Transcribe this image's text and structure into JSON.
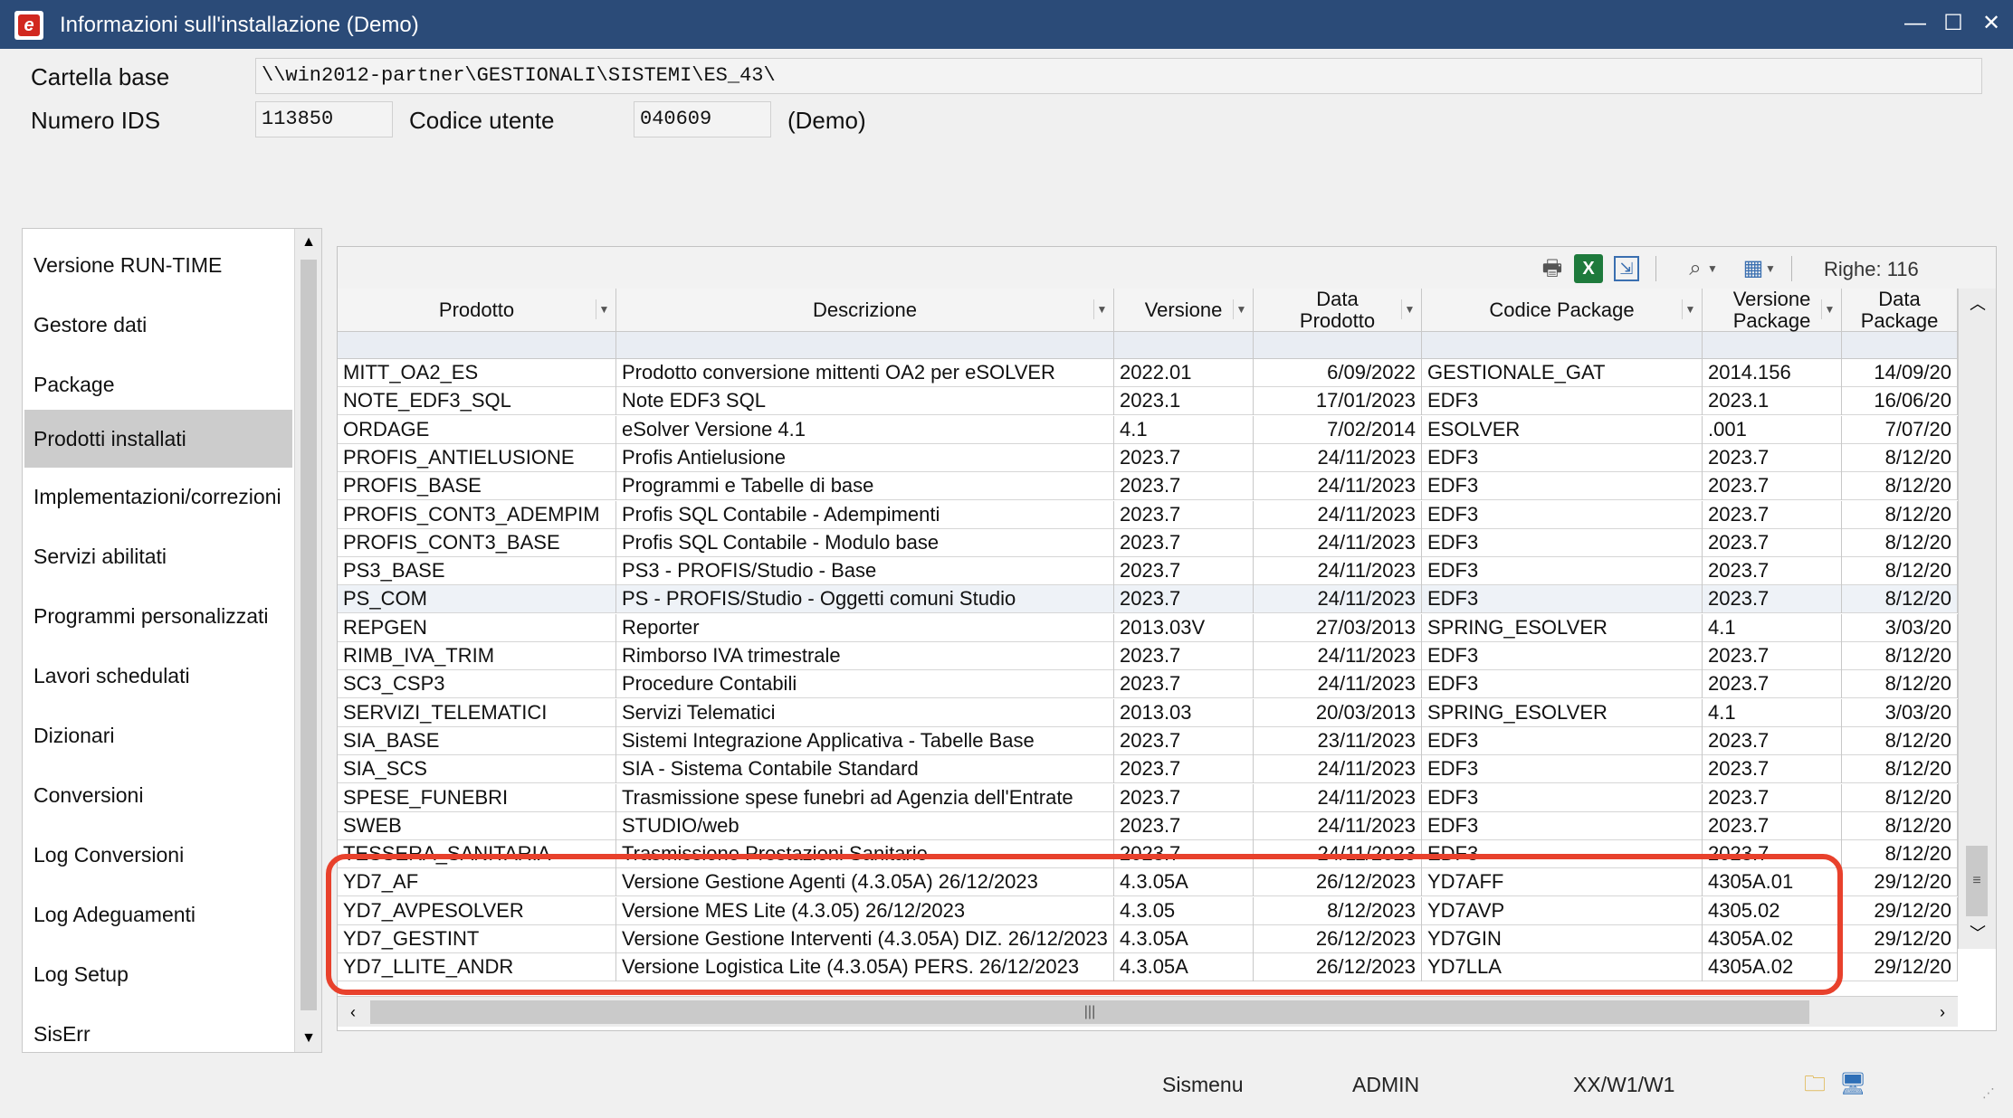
{
  "window": {
    "title": "Informazioni sull'installazione  (Demo)",
    "icon": "e-logo-icon",
    "minimize_glyph": "—",
    "maximize_glyph": "☐",
    "close_glyph": "✕"
  },
  "header": {
    "base_folder_label": "Cartella base",
    "base_folder_value": "\\\\win2012-partner\\GESTIONALI\\SISTEMI\\ES_43\\",
    "ids_label": "Numero IDS",
    "ids_value": "113850",
    "user_code_label": "Codice utente",
    "user_code_value": "040609",
    "demo_label": "(Demo)"
  },
  "sidebar": {
    "items": [
      {
        "label": "Versione RUN-TIME"
      },
      {
        "label": "Gestore dati"
      },
      {
        "label": "Package"
      },
      {
        "label": "Prodotti installati"
      },
      {
        "label": "Implementazioni/correzioni"
      },
      {
        "label": "Servizi abilitati"
      },
      {
        "label": "Programmi personalizzati"
      },
      {
        "label": "Lavori schedulati"
      },
      {
        "label": "Dizionari"
      },
      {
        "label": "Conversioni"
      },
      {
        "label": "Log Conversioni"
      },
      {
        "label": "Log Adeguamenti"
      },
      {
        "label": "Log Setup"
      },
      {
        "label": "SisErr"
      }
    ],
    "active_index": 3
  },
  "toolbar": {
    "rows_count_label": "Righe: 116"
  },
  "grid": {
    "columns": [
      {
        "label": "Prodotto"
      },
      {
        "label": "Descrizione"
      },
      {
        "label": "Versione"
      },
      {
        "label": "Data Prodotto"
      },
      {
        "label": "Codice Package"
      },
      {
        "label": "Versione Package"
      },
      {
        "label": "Data Package"
      }
    ],
    "rows": [
      [
        "MITT_OA2_ES",
        "Prodotto conversione mittenti OA2 per eSOLVER",
        "2022.01",
        "6/09/2022",
        "GESTIONALE_GAT",
        "2014.156",
        "14/09/20"
      ],
      [
        "NOTE_EDF3_SQL",
        "Note EDF3 SQL",
        "2023.1",
        "17/01/2023",
        "EDF3",
        "2023.1",
        "16/06/20"
      ],
      [
        "ORDAGE",
        "eSolver Versione 4.1",
        "4.1",
        "7/02/2014",
        "ESOLVER",
        ".001",
        "7/07/20"
      ],
      [
        "PROFIS_ANTIELUSIONE",
        "Profis Antielusione",
        "2023.7",
        "24/11/2023",
        "EDF3",
        "2023.7",
        "8/12/20"
      ],
      [
        "PROFIS_BASE",
        "Programmi e Tabelle di base",
        "2023.7",
        "24/11/2023",
        "EDF3",
        "2023.7",
        "8/12/20"
      ],
      [
        "PROFIS_CONT3_ADEMPIM",
        "Profis SQL Contabile - Adempimenti",
        "2023.7",
        "24/11/2023",
        "EDF3",
        "2023.7",
        "8/12/20"
      ],
      [
        "PROFIS_CONT3_BASE",
        "Profis SQL Contabile - Modulo base",
        "2023.7",
        "24/11/2023",
        "EDF3",
        "2023.7",
        "8/12/20"
      ],
      [
        "PS3_BASE",
        "PS3 - PROFIS/Studio - Base",
        "2023.7",
        "24/11/2023",
        "EDF3",
        "2023.7",
        "8/12/20"
      ],
      [
        "PS_COM",
        "PS - PROFIS/Studio - Oggetti comuni Studio",
        "2023.7",
        "24/11/2023",
        "EDF3",
        "2023.7",
        "8/12/20"
      ],
      [
        "REPGEN",
        "Reporter",
        "2013.03V",
        "27/03/2013",
        "SPRING_ESOLVER",
        "4.1",
        "3/03/20"
      ],
      [
        "RIMB_IVA_TRIM",
        "Rimborso IVA trimestrale",
        "2023.7",
        "24/11/2023",
        "EDF3",
        "2023.7",
        "8/12/20"
      ],
      [
        "SC3_CSP3",
        "Procedure Contabili",
        "2023.7",
        "24/11/2023",
        "EDF3",
        "2023.7",
        "8/12/20"
      ],
      [
        "SERVIZI_TELEMATICI",
        "Servizi Telematici",
        "2013.03",
        "20/03/2013",
        "SPRING_ESOLVER",
        "4.1",
        "3/03/20"
      ],
      [
        "SIA_BASE",
        "Sistemi Integrazione Applicativa - Tabelle Base",
        "2023.7",
        "23/11/2023",
        "EDF3",
        "2023.7",
        "8/12/20"
      ],
      [
        "SIA_SCS",
        "SIA - Sistema Contabile Standard",
        "2023.7",
        "24/11/2023",
        "EDF3",
        "2023.7",
        "8/12/20"
      ],
      [
        "SPESE_FUNEBRI",
        "Trasmissione spese funebri ad Agenzia dell'Entrate",
        "2023.7",
        "24/11/2023",
        "EDF3",
        "2023.7",
        "8/12/20"
      ],
      [
        "SWEB",
        "STUDIO/web",
        "2023.7",
        "24/11/2023",
        "EDF3",
        "2023.7",
        "8/12/20"
      ],
      [
        "TESSERA_SANITARIA",
        "Trasmissione Prestazioni Sanitarie",
        "2023.7",
        "24/11/2023",
        "EDF3",
        "2023.7",
        "8/12/20"
      ],
      [
        "YD7_AF",
        "Versione Gestione Agenti (4.3.05A) 26/12/2023",
        "4.3.05A",
        "26/12/2023",
        "YD7AFF",
        "4305A.01",
        "29/12/20"
      ],
      [
        "YD7_AVPESOLVER",
        "Versione MES Lite (4.3.05) 26/12/2023",
        "4.3.05",
        "8/12/2023",
        "YD7AVP",
        "4305.02",
        "29/12/20"
      ],
      [
        "YD7_GESTINT",
        "Versione Gestione Interventi (4.3.05A) DIZ. 26/12/2023",
        "4.3.05A",
        "26/12/2023",
        "YD7GIN",
        "4305A.02",
        "29/12/20"
      ],
      [
        "YD7_LLITE_ANDR",
        "Versione Logistica Lite (4.3.05A) PERS. 26/12/2023",
        "4.3.05A",
        "26/12/2023",
        "YD7LLA",
        "4305A.02",
        "29/12/20"
      ]
    ]
  },
  "statusbar": {
    "module": "Sismenu",
    "user": "ADMIN",
    "path": "XX/W1/W1"
  },
  "colors": {
    "titlebar": "#2b4b78",
    "highlight": "#e8412c",
    "row_alt": "#eef2f7",
    "active_menu": "#cccccc"
  }
}
